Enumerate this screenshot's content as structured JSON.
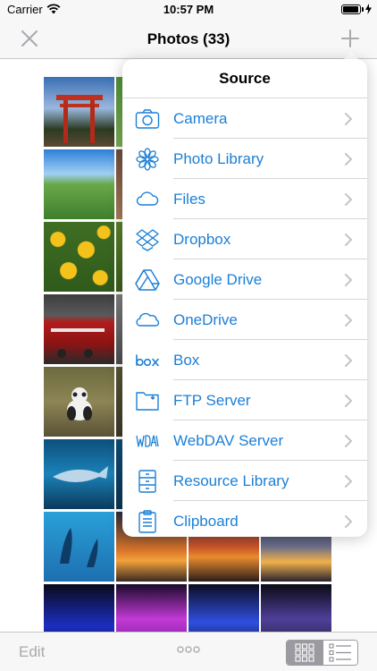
{
  "status_bar": {
    "carrier": "Carrier",
    "time": "10:57 PM",
    "battery_level": 0.95
  },
  "nav": {
    "title": "Photos (33)"
  },
  "popover": {
    "title": "Source",
    "items": [
      {
        "label": "Camera",
        "icon": "camera-icon"
      },
      {
        "label": "Photo Library",
        "icon": "photo-library-icon"
      },
      {
        "label": "Files",
        "icon": "cloud-icon"
      },
      {
        "label": "Dropbox",
        "icon": "dropbox-icon"
      },
      {
        "label": "Google Drive",
        "icon": "google-drive-icon"
      },
      {
        "label": "OneDrive",
        "icon": "onedrive-icon"
      },
      {
        "label": "Box",
        "icon": "box-icon"
      },
      {
        "label": "FTP Server",
        "icon": "ftp-folder-icon"
      },
      {
        "label": "WebDAV Server",
        "icon": "webdav-icon"
      },
      {
        "label": "Resource Library",
        "icon": "cabinet-icon"
      },
      {
        "label": "Clipboard",
        "icon": "clipboard-icon"
      }
    ]
  },
  "toolbar": {
    "edit_label": "Edit"
  },
  "colors": {
    "accent": "#1b7fd6",
    "disabled": "#a9a9ae"
  }
}
